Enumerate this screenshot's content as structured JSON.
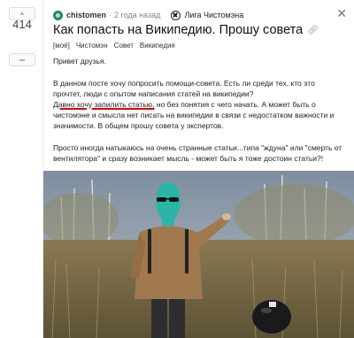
{
  "rating": {
    "score": "414",
    "up_label": "▲",
    "down_label": "▬"
  },
  "header": {
    "author": "chistomen",
    "separator": "·",
    "time": "2 года назад",
    "league": "Лига Чистомэна",
    "close_label": "✕"
  },
  "post": {
    "title": "Как попасть на Википедию. Прошу совета",
    "tags": [
      "[моё]",
      "Чистомэн",
      "Совет",
      "Википедия"
    ],
    "greeting": "Привет друзья.",
    "paragraph1": "В данном посте хочу попросить помощи-совета. Есть ли среди тех, кто это прочтет, люди с опытом написания статей на википедии?",
    "paragraph2_underlined": "Давно хочу запилить статью,",
    "paragraph2_rest": " но без понятия с чего начать. А может быть о чистомэне и смысла нет писать на википедии в связи с недостатком важности и значимости. В общем прошу совета у экспертов.",
    "paragraph3": "Просто иногда натыкаюсь на очень странные статьи...типа \"ждуна\" или \"смерть от вентилятора\" и сразу возникает мысль - может быть я тоже достоин статьи?!"
  },
  "icons": {
    "vote_up": "arrow-up-icon",
    "vote_down": "minus-icon",
    "link": "link-icon",
    "close": "close-icon"
  },
  "colors": {
    "avatar": "#1f8a5b",
    "underline": "#d60000",
    "balaclava": "#2bb5a8"
  }
}
